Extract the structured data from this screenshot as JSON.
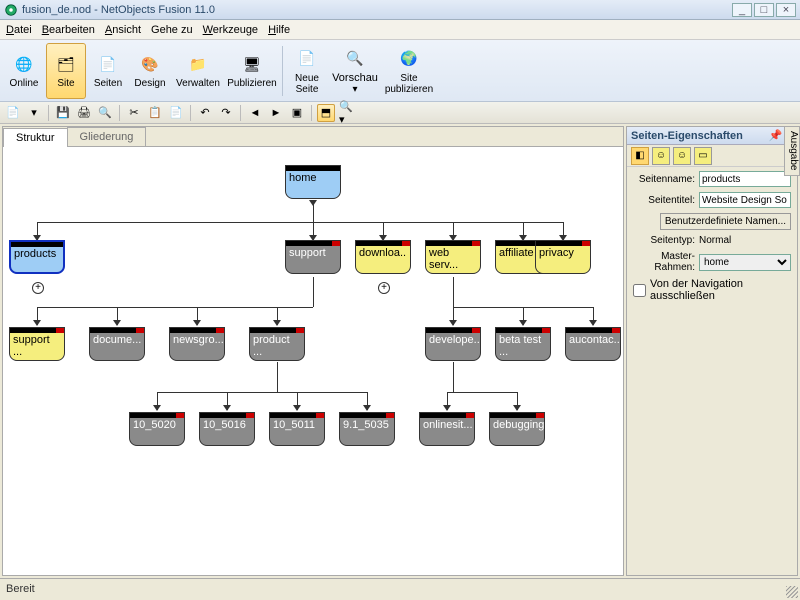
{
  "window": {
    "file": "fusion_de.nod",
    "app": "NetObjects Fusion 11.0"
  },
  "menu": {
    "datei": "Datei",
    "bearbeiten": "Bearbeiten",
    "ansicht": "Ansicht",
    "gehezu": "Gehe zu",
    "werkzeuge": "Werkzeuge",
    "hilfe": "Hilfe"
  },
  "ribbon": {
    "online": "Online",
    "site": "Site",
    "seiten": "Seiten",
    "design": "Design",
    "verwalten": "Verwalten",
    "publizieren": "Publizieren",
    "neueSeite": "Neue Seite",
    "vorschau": "Vorschau",
    "sitePublizieren": "Site publizieren"
  },
  "tabs": {
    "struktur": "Struktur",
    "gliederung": "Gliederung"
  },
  "nodes": {
    "home": "home",
    "products": "products",
    "support": "support",
    "downloa": "downloa..",
    "webserv": "web serv...",
    "affiliate": "affiliate",
    "privacy": "privacy",
    "support2": "support ...",
    "docume": "docume...",
    "newsgro": "newsgro...",
    "product": "product ...",
    "develope": "develope...",
    "betatest": "beta test ...",
    "aucontac": "aucontac...",
    "10_5020": "10_5020",
    "10_5016": "10_5016",
    "10_5011": "10_5011",
    "91_5035": "9.1_5035",
    "onlinesit": "onlinesit...",
    "debugging": "debugging"
  },
  "panel": {
    "title": "Seiten-Eigenschaften",
    "seitenname_lbl": "Seitenname:",
    "seitenname_val": "products",
    "seitentitel_lbl": "Seitentitel:",
    "seitentitel_val": "Website Design So",
    "benutzerdef": "Benutzerdefiniete Namen...",
    "seitentyp_lbl": "Seitentyp:",
    "seitentyp_val": "Normal",
    "master_lbl": "Master-Rahmen:",
    "master_val": "home",
    "navcheck": "Von der Navigation ausschließen"
  },
  "sidetab": "Ausgabe",
  "status": "Bereit"
}
